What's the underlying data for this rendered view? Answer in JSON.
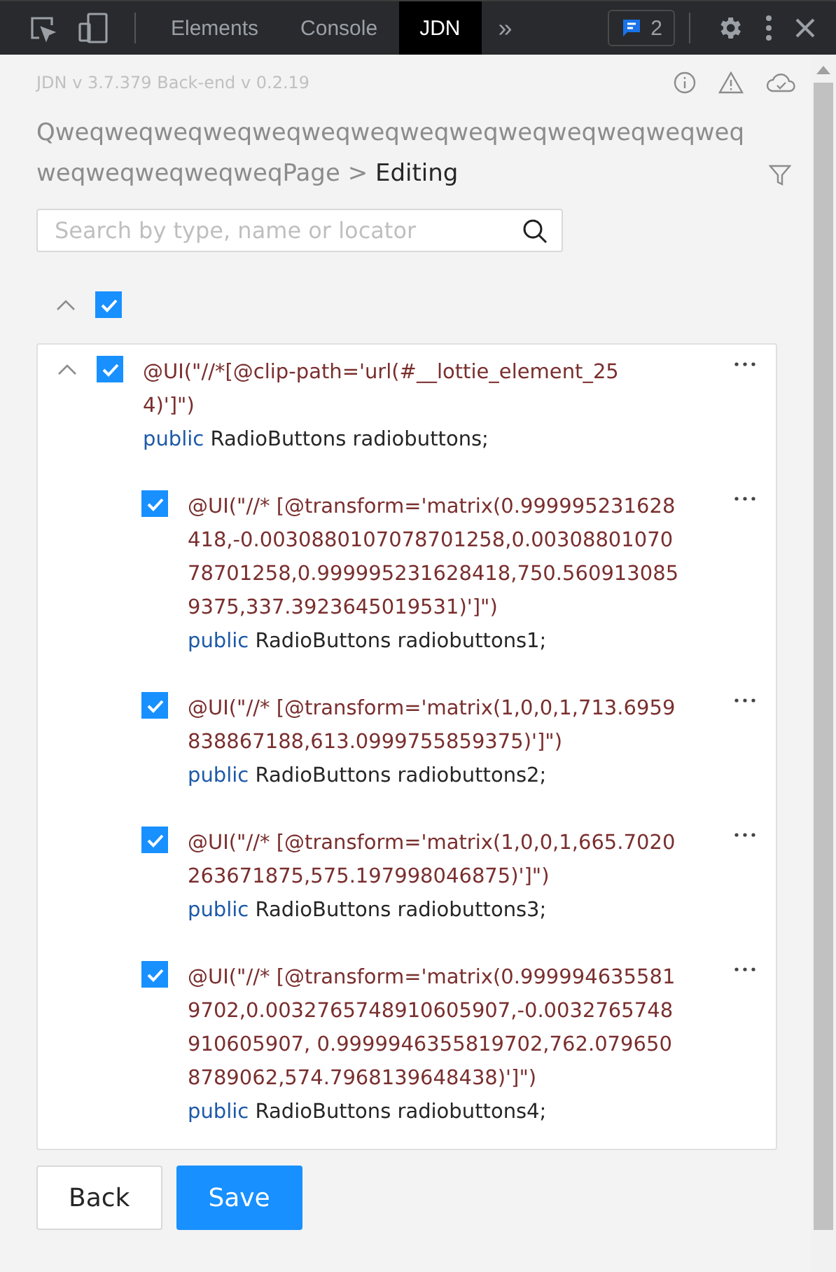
{
  "devtools": {
    "tabs": [
      {
        "label": "Elements",
        "selected": false
      },
      {
        "label": "Console",
        "selected": false
      },
      {
        "label": "JDN",
        "selected": true
      }
    ],
    "more": "»",
    "messages_count": "2"
  },
  "header": {
    "version": "JDN v 3.7.379 Back-end v 0.2.19"
  },
  "breadcrumb": {
    "page": "QweqweqweqweqweqweqweqweqweqweqweqweqweqweqweqweqweqweqweqPage",
    "separator": ">",
    "current": "Editing"
  },
  "search": {
    "placeholder": "Search by type, name or locator"
  },
  "tree": {
    "expanded": true,
    "checked": true,
    "elements": [
      {
        "expanded": true,
        "checked": true,
        "locator": "@UI(\"//*[@clip-path='url(#__lottie_element_254)']\")",
        "keyword": "public",
        "declaration": "RadioButtons radiobuttons;",
        "children": [
          {
            "checked": true,
            "locator": "@UI(\"//* [@transform='matrix(0.999995231628418,-0.0030880107078701258,0.0030880107078701258,0.999995231628418,750.5609130859375,337.3923645019531)']\")",
            "keyword": "public",
            "declaration": "RadioButtons radiobuttons1;"
          },
          {
            "checked": true,
            "locator": "@UI(\"//* [@transform='matrix(1,0,0,1,713.6959838867188,613.0999755859375)']\")",
            "keyword": "public",
            "declaration": "RadioButtons radiobuttons2;"
          },
          {
            "checked": true,
            "locator": "@UI(\"//* [@transform='matrix(1,0,0,1,665.7020263671875,575.197998046875)']\")",
            "keyword": "public",
            "declaration": "RadioButtons radiobuttons3;"
          },
          {
            "checked": true,
            "locator": "@UI(\"//* [@transform='matrix(0.9999946355819702,0.0032765748910605907,-0.0032765748910605907, 0.9999946355819702,762.0796508789062,574.7968139648438)']\")",
            "keyword": "public",
            "declaration": "RadioButtons radiobuttons4;"
          }
        ]
      }
    ]
  },
  "buttons": [
    {
      "label": "Back",
      "kind": "secondary"
    },
    {
      "label": "Save",
      "kind": "primary"
    }
  ]
}
